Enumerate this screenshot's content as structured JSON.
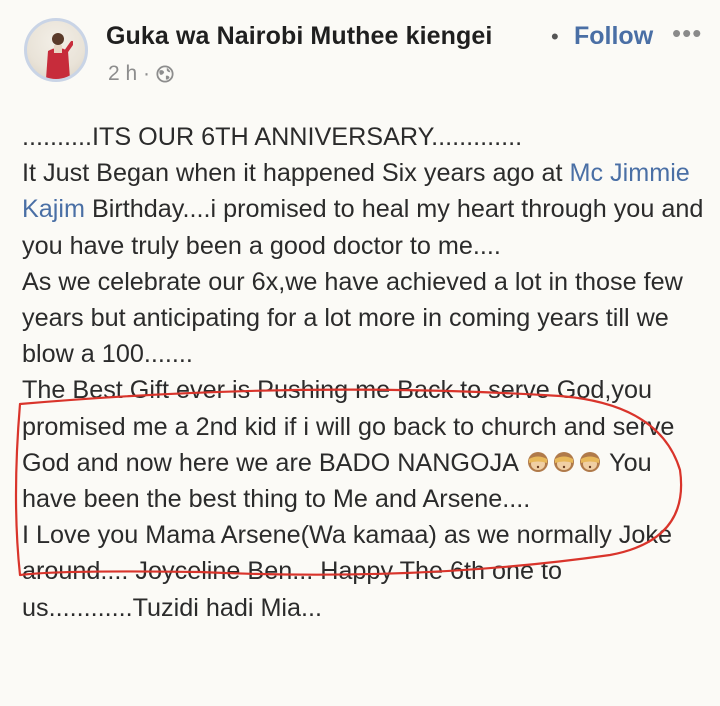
{
  "author": {
    "name": "Guka wa Nairobi Muthee kiengei",
    "follow_label": "Follow",
    "separator": "•",
    "more_label": "•••",
    "timestamp": "2 h ·",
    "privacy_icon": "globe-icon",
    "avatar_icon": "profile-photo"
  },
  "post": {
    "line_1": "..........ITS OUR 6TH ANNIVERSARY.............",
    "line_2_pre": "It Just Began when it happened Six years ago at ",
    "mention": "Mc Jimmie Kajim",
    "line_2_post": "  Birthday....i promised to heal my heart through you and you have truly been a good doctor to me....",
    "line_3": "As we celebrate our 6x,we have achieved a lot in those few years but anticipating for a lot more in coming years till we blow a 100.......",
    "line_4_pre": "The Best Gift ever is Pushing me Back to serve God,you promised me a 2nd kid if i will go back to church and serve God and now here we are BADO NANGOJA ",
    "emoji_name": "see-no-evil-monkey",
    "line_4_post": " You have been the best thing to Me and Arsene....",
    "line_5": "I Love you Mama Arsene(Wa kamaa) as we normally Joke around.... Joyceline Ben...  Happy The 6th one to us............Tuzidi hadi Mia..."
  },
  "colors": {
    "link": "#4a6fa5",
    "annotation": "#d9342b",
    "background": "#fbfaf6"
  }
}
